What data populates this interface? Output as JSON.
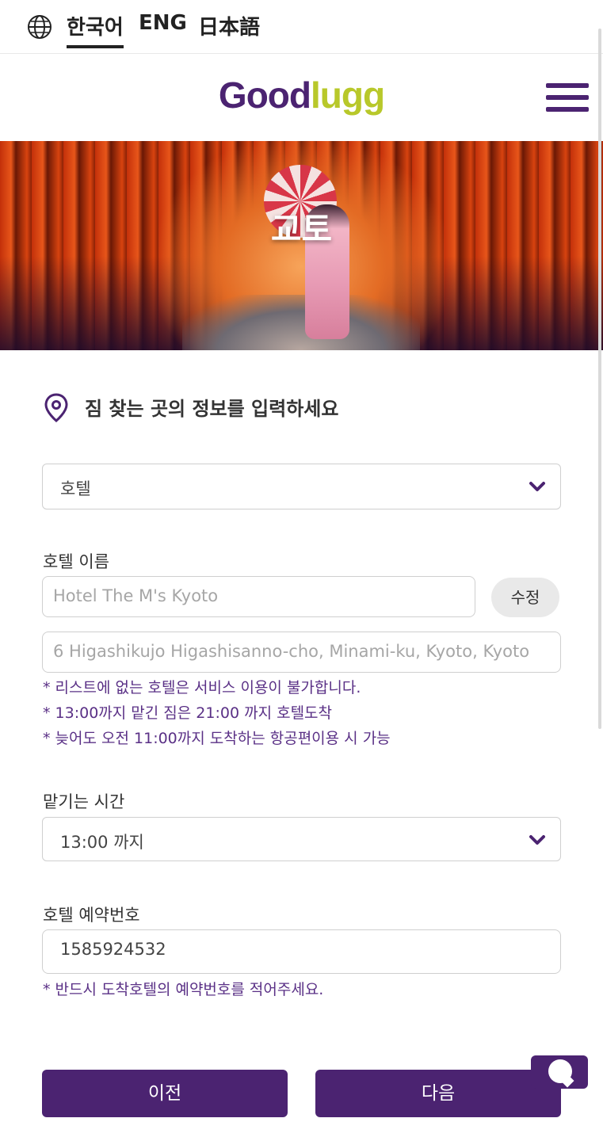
{
  "language_bar": {
    "globe_icon": "globe-icon",
    "languages": [
      "한국어",
      "ENG",
      "日本語"
    ],
    "active": "한국어"
  },
  "header": {
    "logo_part1": "Good",
    "logo_part2": "lugg",
    "logo_color1": "#4b2371",
    "logo_color2": "#b8c82a",
    "menu_icon": "hamburger-icon"
  },
  "hero": {
    "title": "교토"
  },
  "form": {
    "section_title": "짐 찾는 곳의 정보를 입력하세요",
    "section_icon": "location-pin-icon",
    "place_type": {
      "value": "호텔",
      "icon": "chevron-down-icon"
    },
    "hotel_name": {
      "label": "호텔 이름",
      "placeholder": "Hotel The M's Kyoto",
      "edit_label": "수정"
    },
    "hotel_address": {
      "placeholder": "6 Higashikujo Higashisanno-cho, Minami-ku, Kyoto, Kyoto"
    },
    "notes": [
      "* 리스트에 없는 호텔은 서비스 이용이 불가합니다.",
      "* 13:00까지 맡긴 짐은 21:00 까지 호텔도착",
      "* 늦어도 오전 11:00까지 도착하는 항공편이용 시 가능"
    ],
    "drop_time": {
      "label": "맡기는 시간",
      "value": "13:00 까지",
      "icon": "chevron-down-icon"
    },
    "reservation": {
      "label": "호텔 예약번호",
      "value": "1585924532",
      "note": "* 반드시 도착호텔의 예약번호를 적어주세요."
    }
  },
  "buttons": {
    "prev": "이전",
    "next": "다음"
  },
  "chat_widget": {
    "icon": "chat-icon"
  },
  "colors": {
    "primary": "#4b2371",
    "accent": "#b8c82a",
    "note_text": "#5a3086"
  }
}
